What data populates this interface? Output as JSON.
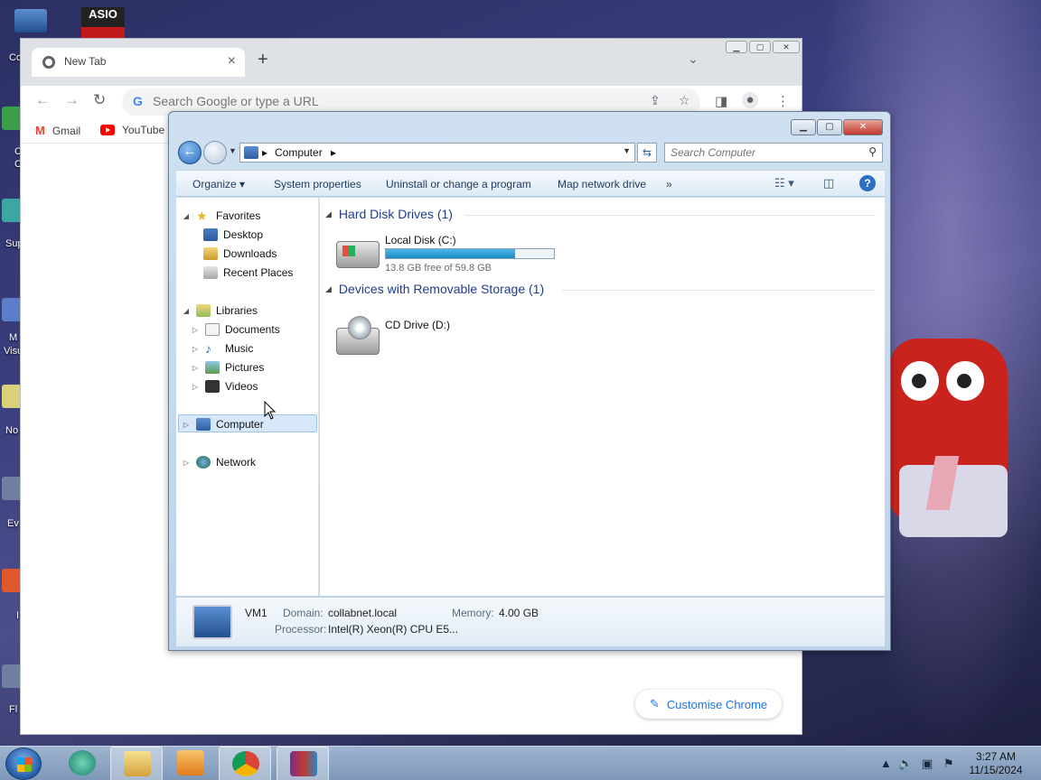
{
  "desktop": {
    "icon_labels": [
      "Co",
      "C",
      "C",
      "Sup",
      "M",
      "Visu",
      "No",
      "Ev",
      "I",
      "Fl"
    ],
    "asio_label": "ASIO"
  },
  "chrome": {
    "tab_title": "New Tab",
    "new_tab_symbol": "+",
    "omnibox_placeholder": "Search Google or type a URL",
    "bookmarks": [
      {
        "label": "Gmail"
      },
      {
        "label": "YouTube"
      }
    ],
    "customise_label": "Customise Chrome"
  },
  "explorer": {
    "breadcrumb": [
      "Computer"
    ],
    "search_placeholder": "Search Computer",
    "commands": {
      "organize": "Organize",
      "system_properties": "System properties",
      "uninstall": "Uninstall or change a program",
      "map_drive": "Map network drive",
      "more": "»"
    },
    "nav": {
      "favorites": "Favorites",
      "desktop": "Desktop",
      "downloads": "Downloads",
      "recent_places": "Recent Places",
      "libraries": "Libraries",
      "documents": "Documents",
      "music": "Music",
      "pictures": "Pictures",
      "videos": "Videos",
      "computer": "Computer",
      "network": "Network"
    },
    "groups": {
      "hard_disk": "Hard Disk Drives (1)",
      "removable": "Devices with Removable Storage (1)"
    },
    "drives": {
      "c_name": "Local Disk (C:)",
      "c_free": "13.8 GB free of 59.8 GB",
      "c_used_fraction": 0.77,
      "d_name": "CD Drive (D:)"
    },
    "details": {
      "computer_name": "VM1",
      "domain_label": "Domain:",
      "domain_value": "collabnet.local",
      "memory_label": "Memory:",
      "memory_value": "4.00 GB",
      "processor_label": "Processor:",
      "processor_value": "Intel(R) Xeon(R) CPU E5..."
    }
  },
  "taskbar": {
    "time": "3:27 AM",
    "date": "11/15/2024"
  },
  "colors": {
    "accent_blue": "#1e3d8a",
    "disk_fill": "#1a8bc4",
    "chrome_link": "#1a73e8"
  }
}
